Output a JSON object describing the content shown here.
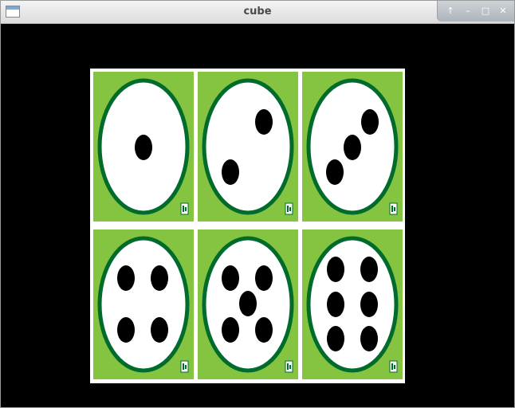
{
  "window": {
    "title": "cube"
  },
  "controls": {
    "up_icon": "arrow-up-icon",
    "min_icon": "minimize-icon",
    "max_icon": "maximize-icon",
    "close_icon": "close-icon"
  },
  "colors": {
    "tile_bg": "#85c441",
    "ring": "#006b2a",
    "face": "#ffffff",
    "pip": "#000000",
    "board_border": "#ffffff",
    "viewport_bg": "#000000"
  },
  "dice": [
    {
      "label": "1",
      "pips": 1
    },
    {
      "label": "2",
      "pips": 2
    },
    {
      "label": "3",
      "pips": 3
    },
    {
      "label": "4",
      "pips": 4
    },
    {
      "label": "5",
      "pips": 5
    },
    {
      "label": "6",
      "pips": 6
    }
  ]
}
